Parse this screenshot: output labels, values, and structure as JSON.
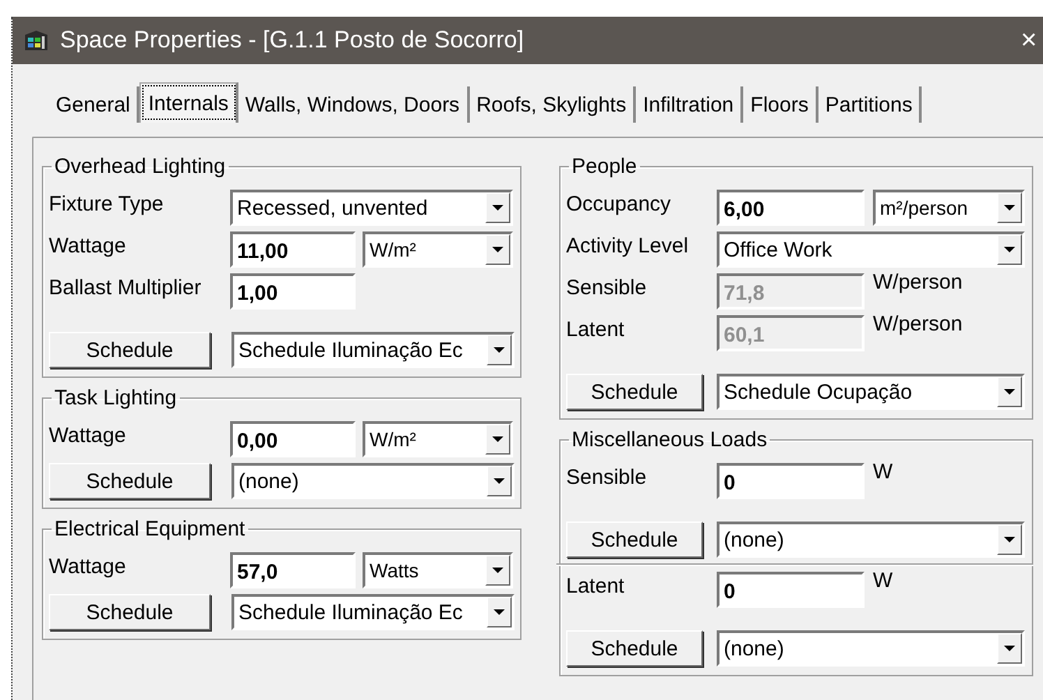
{
  "window": {
    "title": "Space Properties - [G.1.1 Posto de Socorro]",
    "close": "×"
  },
  "tabs": [
    {
      "label": "General",
      "selected": false
    },
    {
      "label": "Internals",
      "selected": true
    },
    {
      "label": "Walls, Windows, Doors",
      "selected": false
    },
    {
      "label": "Roofs, Skylights",
      "selected": false
    },
    {
      "label": "Infiltration",
      "selected": false
    },
    {
      "label": "Floors",
      "selected": false
    },
    {
      "label": "Partitions",
      "selected": false
    }
  ],
  "left_groups": [
    {
      "title": "Overhead Lighting",
      "rows": [
        {
          "kind": "select",
          "label": "Fixture Type",
          "value": "Recessed, unvented"
        },
        {
          "kind": "number_select",
          "label": "Wattage",
          "value": "11,00",
          "unit": "W/m²"
        },
        {
          "kind": "number",
          "label": "Ballast Multiplier",
          "value": "1,00",
          "disabled": false
        },
        {
          "kind": "schedule",
          "button": "Schedule",
          "value": "Schedule Iluminação Ec"
        }
      ]
    },
    {
      "title": "Task Lighting",
      "rows": [
        {
          "kind": "number_select",
          "label": "Wattage",
          "value": "0,00",
          "unit": "W/m²"
        },
        {
          "kind": "schedule",
          "button": "Schedule",
          "value": "(none)"
        }
      ]
    },
    {
      "title": "Electrical Equipment",
      "rows": [
        {
          "kind": "number_select",
          "label": "Wattage",
          "value": "57,0",
          "unit": "Watts"
        },
        {
          "kind": "schedule",
          "button": "Schedule",
          "value": "Schedule Iluminação Ec"
        }
      ]
    }
  ],
  "right_groups": [
    {
      "title": "People",
      "rows": [
        {
          "kind": "number_select",
          "label": "Occupancy",
          "value": "6,00",
          "unit": "m²/person"
        },
        {
          "kind": "select",
          "label": "Activity Level",
          "value": "Office Work"
        },
        {
          "kind": "number",
          "label": "Sensible",
          "value": "71,8",
          "unit_text": "W/person",
          "disabled": true
        },
        {
          "kind": "number",
          "label": "Latent",
          "value": "60,1",
          "unit_text": "W/person",
          "disabled": true
        },
        {
          "kind": "schedule",
          "button": "Schedule",
          "value": "Schedule Ocupação"
        }
      ]
    },
    {
      "title": "Miscellaneous Loads",
      "rows": [
        {
          "kind": "number",
          "label": "Sensible",
          "value": "0",
          "unit_text": "W",
          "disabled": false
        },
        {
          "kind": "schedule",
          "button": "Schedule",
          "value": "(none)"
        },
        {
          "kind": "separator"
        },
        {
          "kind": "number",
          "label": "Latent",
          "value": "0",
          "unit_text": "W",
          "disabled": false
        },
        {
          "kind": "schedule",
          "button": "Schedule",
          "value": "(none)"
        }
      ]
    }
  ]
}
